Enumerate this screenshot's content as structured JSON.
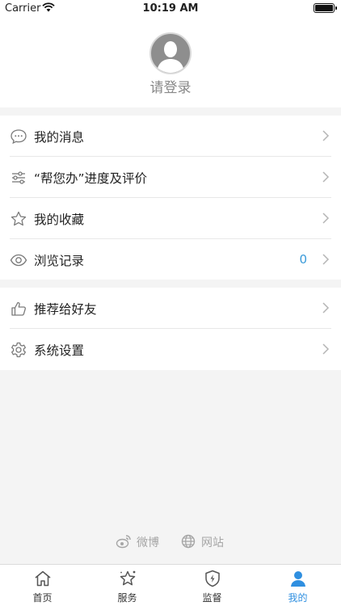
{
  "status_bar": {
    "carrier": "Carrier",
    "time": "10:19 AM"
  },
  "profile": {
    "login_text": "请登录"
  },
  "menu": {
    "group1": [
      {
        "label": "我的消息",
        "icon": "chat-bubble-icon"
      },
      {
        "label": "“帮您办”进度及评价",
        "icon": "sliders-icon"
      },
      {
        "label": "我的收藏",
        "icon": "star-icon"
      },
      {
        "label": "浏览记录",
        "icon": "eye-icon",
        "badge": "0"
      }
    ],
    "group2": [
      {
        "label": "推荐给好友",
        "icon": "thumbs-up-icon"
      },
      {
        "label": "系统设置",
        "icon": "gear-icon"
      }
    ]
  },
  "footer_links": {
    "weibo": "微博",
    "website": "网站"
  },
  "tabs": [
    {
      "label": "首页",
      "icon": "home-icon"
    },
    {
      "label": "服务",
      "icon": "service-star-icon"
    },
    {
      "label": "监督",
      "icon": "shield-icon"
    },
    {
      "label": "我的",
      "icon": "user-icon",
      "active": true
    }
  ],
  "colors": {
    "accent": "#2f8fe0",
    "badge": "#3a9ad9",
    "background": "#f4f4f4"
  }
}
